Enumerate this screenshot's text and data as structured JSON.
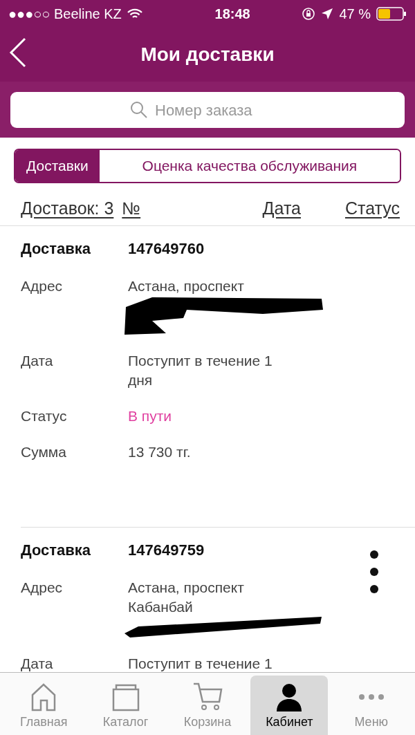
{
  "status_bar": {
    "carrier": "●●●○○ Beeline KZ",
    "time": "18:48",
    "battery": "47 %"
  },
  "header": {
    "title": "Мои доставки"
  },
  "search": {
    "placeholder": "Номер заказа"
  },
  "segments": [
    {
      "label": "Доставки",
      "selected": true
    },
    {
      "label": "Оценка качества обслуживания",
      "selected": false
    }
  ],
  "columns": {
    "count": "Доставок: 3",
    "number": "№",
    "date": "Дата",
    "status": "Статус"
  },
  "deliveries": [
    {
      "label": "Доставка",
      "number": "147649760",
      "menu": false,
      "fields": [
        {
          "kind": "address",
          "label": "Адрес",
          "lines": [
            "Астана, проспект"
          ],
          "redacted": true
        },
        {
          "kind": "text",
          "label": "Дата",
          "lines": [
            "Поступит в течение 1",
            "дня"
          ]
        },
        {
          "kind": "status",
          "label": "Статус",
          "lines": [
            "В пути"
          ],
          "color": "#e040a0"
        },
        {
          "kind": "text",
          "label": "Сумма",
          "lines": [
            "13 730 тг."
          ]
        }
      ]
    },
    {
      "label": "Доставка",
      "number": "147649759",
      "menu": true,
      "fields": [
        {
          "kind": "address",
          "label": "Адрес",
          "lines": [
            "Астана, проспект",
            "Кабанбай"
          ],
          "redacted": true
        },
        {
          "kind": "text",
          "label": "Дата",
          "lines": [
            "Поступит в течение 1"
          ]
        }
      ]
    }
  ],
  "tabbar": [
    {
      "label": "Главная",
      "selected": false
    },
    {
      "label": "Каталог",
      "selected": false
    },
    {
      "label": "Корзина",
      "selected": false
    },
    {
      "label": "Кабинет",
      "selected": true
    },
    {
      "label": "Меню",
      "selected": false
    }
  ]
}
